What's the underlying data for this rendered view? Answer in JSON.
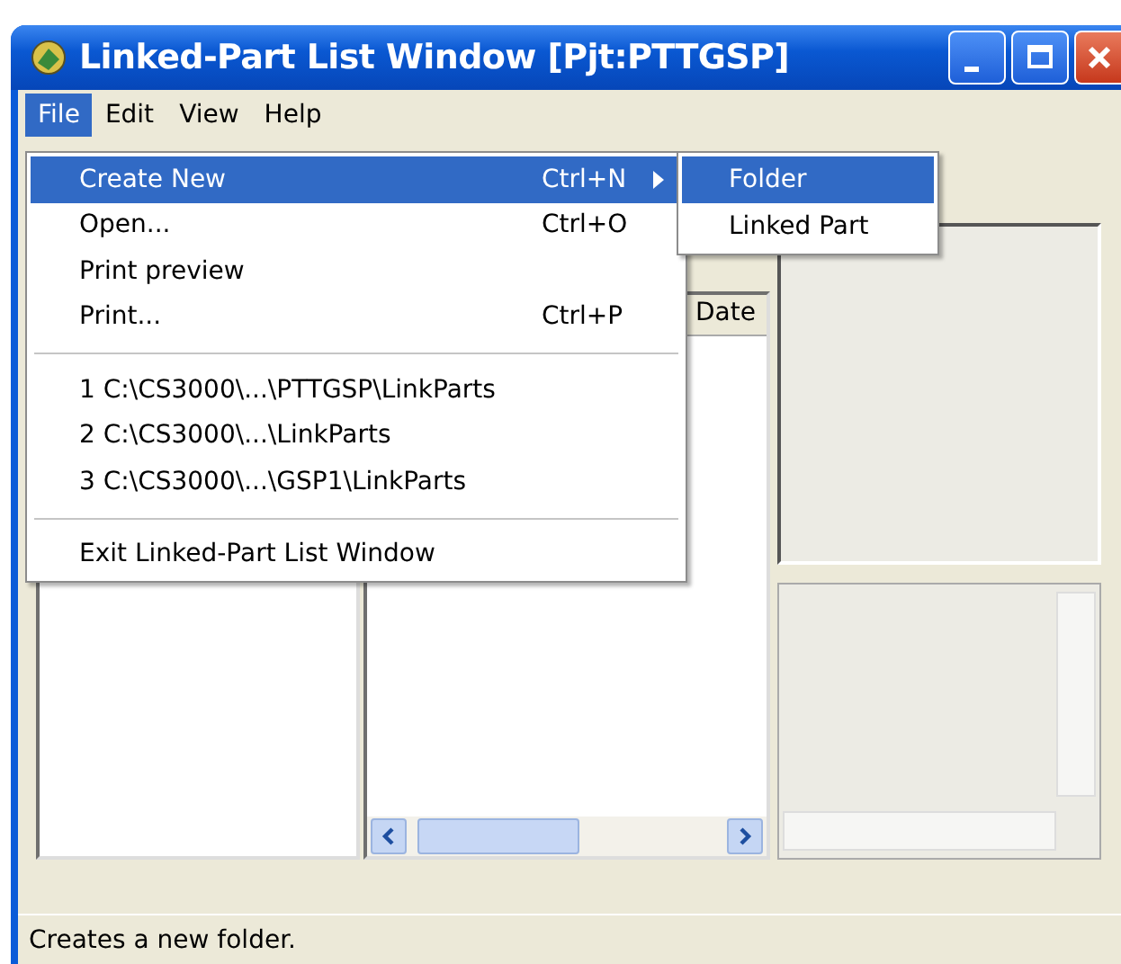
{
  "window": {
    "title": "Linked-Part List Window [Pjt:PTTGSP]"
  },
  "menubar": [
    {
      "label": "File",
      "selected": true
    },
    {
      "label": "Edit",
      "selected": false
    },
    {
      "label": "View",
      "selected": false
    },
    {
      "label": "Help",
      "selected": false
    }
  ],
  "file_menu": [
    {
      "kind": "item",
      "label": "Create New",
      "shortcut": "Ctrl+N",
      "submenu": true,
      "selected": true
    },
    {
      "kind": "item",
      "label": "Open...",
      "shortcut": "Ctrl+O",
      "submenu": false,
      "selected": false
    },
    {
      "kind": "item",
      "label": "Print preview",
      "submenu": false,
      "selected": false
    },
    {
      "kind": "item",
      "label": "Print...",
      "shortcut": "Ctrl+P",
      "submenu": false,
      "selected": false
    },
    {
      "kind": "separator"
    },
    {
      "kind": "item",
      "label": "1 C:\\CS3000\\...\\PTTGSP\\LinkParts",
      "submenu": false,
      "selected": false
    },
    {
      "kind": "item",
      "label": "2 C:\\CS3000\\...\\LinkParts",
      "submenu": false,
      "selected": false
    },
    {
      "kind": "item",
      "label": "3 C:\\CS3000\\...\\GSP1\\LinkParts",
      "submenu": false,
      "selected": false
    },
    {
      "kind": "separator"
    },
    {
      "kind": "item",
      "label": "Exit Linked-Part List Window",
      "submenu": false,
      "selected": false
    }
  ],
  "submenu": [
    {
      "label": "Folder",
      "selected": true
    },
    {
      "label": "Linked Part",
      "selected": false
    }
  ],
  "list": {
    "columns": [
      "Date"
    ]
  },
  "status_bar": "Creates a new folder."
}
